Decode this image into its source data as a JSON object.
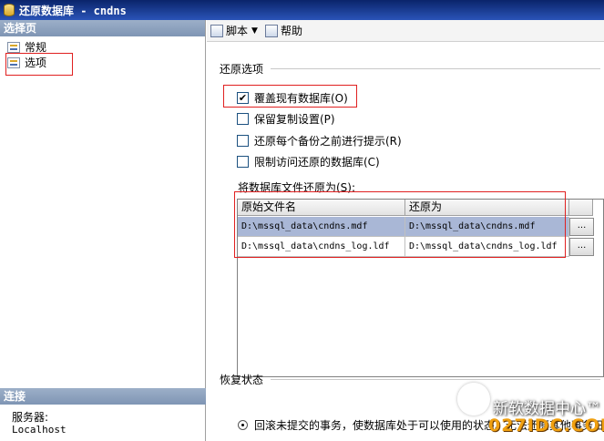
{
  "window": {
    "title": "还原数据库 - cndns"
  },
  "left_pane": {
    "header": "选择页",
    "items": [
      {
        "label": "常规"
      },
      {
        "label": "选项"
      }
    ],
    "connection_header": "连接",
    "server_label": "服务器:",
    "server_value": "Localhost"
  },
  "toolbar": {
    "script_label": "脚本",
    "help_label": "帮助"
  },
  "restore_options": {
    "section_label": "还原选项",
    "checkboxes": [
      {
        "label": "覆盖现有数据库(O)",
        "checked": true
      },
      {
        "label": "保留复制设置(P)",
        "checked": false
      },
      {
        "label": "还原每个备份之前进行提示(R)",
        "checked": false
      },
      {
        "label": "限制访问还原的数据库(C)",
        "checked": false
      }
    ]
  },
  "files": {
    "label": "将数据库文件还原为(S):",
    "columns": [
      "原始文件名",
      "还原为"
    ],
    "rows": [
      {
        "original": "D:\\mssql_data\\cndns.mdf",
        "restore_as": "D:\\mssql_data\\cndns.mdf",
        "browse": "..."
      },
      {
        "original": "D:\\mssql_data\\cndns_log.ldf",
        "restore_as": "D:\\mssql_data\\cndns_log.ldf",
        "browse": "..."
      }
    ]
  },
  "recovery": {
    "section_label": "恢复状态",
    "option_text": "回滚未提交的事务，使数据库处于可以使用的状态。无法还原其他事务日"
  },
  "watermark": {
    "cn": "新软数据中心™",
    "en": "027IDC.COM"
  }
}
